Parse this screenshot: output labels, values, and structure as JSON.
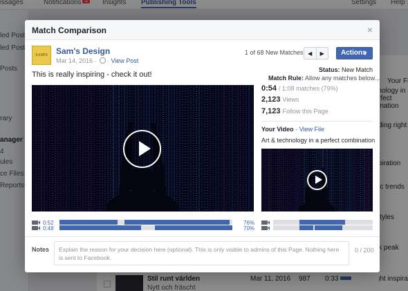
{
  "background": {
    "top_nav": [
      "Messages",
      "Notifications",
      "Insights",
      "Publishing Tools",
      "Settings",
      "Help"
    ],
    "notif_badge": "1",
    "left_items": [
      "led Posts",
      "led Posts",
      "Posts",
      "rary",
      "anager",
      "4",
      "ules",
      "ce Files",
      "Reports"
    ],
    "right_items": [
      "Your File",
      "chnology in",
      "perfect",
      "nbination",
      "ending right",
      "ew",
      "ght",
      "nspiration",
      "agic trends",
      "p styles",
      "eak peak",
      "Light inspiratio"
    ],
    "row": {
      "title": "Stil runt världen",
      "subtitle": "Nytt och fräscht",
      "date": "Mar 11, 2016",
      "count": "987",
      "time": "0:33"
    }
  },
  "dialog": {
    "title": "Match Comparison",
    "close": "×",
    "page_name": "Sam's Design",
    "logo_text": "SAM'S",
    "post_date": "Mar 14, 2016",
    "view_post": "View Post",
    "match_count": "1 of 68 New Matches",
    "prev": "◀",
    "next": "▶",
    "actions": "Actions",
    "caption": "This is really inspiring - check it out!",
    "status_label": "Status:",
    "status_value": "New Match",
    "match_rule_label": "Match Rule:",
    "match_rule_value": "Allow any matches below...",
    "matched_time": "0:54",
    "matched_detail": "/ 1:08 matches (79%)",
    "views_value": "2,123",
    "views_label": "Views",
    "follows_value": "7,123",
    "follows_label": "Follow this Page",
    "your_video_label": "Your Video",
    "view_file": "View File",
    "your_desc": "Art & technology in a perfect combination",
    "timeline": {
      "time_1": "0:52",
      "time_2": "0:48",
      "pct_1": "76%",
      "pct_2": "70%"
    },
    "notes_label": "Notes",
    "notes_placeholder": "Explain the reason for your decision here (optional). This is only visible to admins of this Page. Nothing here is sent to Facebook.",
    "notes_count": "0 / 200"
  },
  "colors": {
    "accent": "#4267b2",
    "link": "#365899"
  }
}
